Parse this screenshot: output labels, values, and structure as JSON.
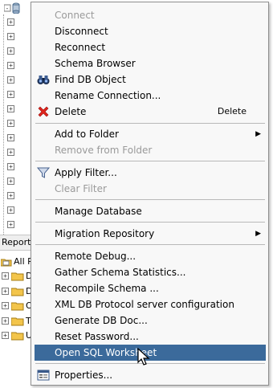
{
  "reports_panel": {
    "header": "Reports",
    "all_reports": "All Re",
    "sub_letters": [
      "D",
      "D",
      "O",
      "T",
      "U"
    ]
  },
  "context_menu": {
    "items": [
      {
        "label": "Connect",
        "enabled": false
      },
      {
        "label": "Disconnect",
        "enabled": true
      },
      {
        "label": "Reconnect",
        "enabled": true
      },
      {
        "label": "Schema Browser",
        "enabled": true
      },
      {
        "label": "Find DB Object",
        "enabled": true,
        "icon": "binoculars-icon"
      },
      {
        "label": "Rename Connection...",
        "enabled": true
      },
      {
        "label": "Delete",
        "enabled": true,
        "icon": "red-x-delete-icon",
        "accelerator": "Delete"
      },
      {
        "label": "Add to Folder",
        "enabled": true,
        "submenu": true
      },
      {
        "label": "Remove from Folder",
        "enabled": false
      },
      {
        "label": "Apply Filter...",
        "enabled": true,
        "icon": "funnel-filter-icon"
      },
      {
        "label": "Clear Filter",
        "enabled": false
      },
      {
        "label": "Manage Database",
        "enabled": true
      },
      {
        "label": "Migration Repository",
        "enabled": true,
        "submenu": true
      },
      {
        "label": "Remote Debug...",
        "enabled": true
      },
      {
        "label": "Gather Schema Statistics...",
        "enabled": true
      },
      {
        "label": "Recompile Schema ...",
        "enabled": true
      },
      {
        "label": "XML DB Protocol server configuration",
        "enabled": true
      },
      {
        "label": "Generate DB Doc...",
        "enabled": true
      },
      {
        "label": "Reset Password...",
        "enabled": true
      },
      {
        "label": "Open SQL Worksheet",
        "enabled": true,
        "selected": true
      },
      {
        "label": "Properties...",
        "enabled": true,
        "icon": "properties-icon"
      }
    ]
  },
  "colors": {
    "selection": "#3b6a9b",
    "disabled_text": "#9a9a9a",
    "menu_bg": "#f8f8f8"
  }
}
